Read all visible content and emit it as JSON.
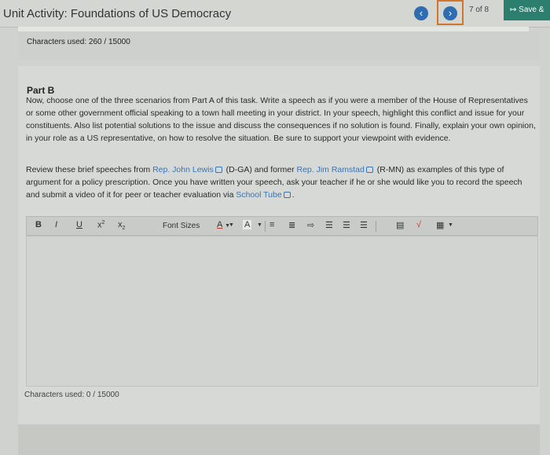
{
  "header": {
    "title": "Unit Activity: Foundations of US Democracy",
    "prev_icon": "chevron-left-icon",
    "next_icon": "chevron-right-icon",
    "page_count": "7 of 8",
    "save_label": "Save &",
    "colors": {
      "accent": "#2f6db0",
      "save": "#2c7f6e",
      "highlight": "#d2742c"
    }
  },
  "part_a": {
    "chars_used": "Characters used: 260 / 15000"
  },
  "part_b": {
    "heading": "Part B",
    "paragraph1": "Now, choose one of the three scenarios from Part A of this task. Write a speech as if you were a member of the House of Representatives or some other government official speaking to a town hall meeting in your district. In your speech, highlight this conflict and issue for your constituents. Also list potential solutions to the issue and discuss the consequences if no solution is found. Finally, explain your own opinion, in your role as a US representative, on how to resolve the situation. Be sure to support your viewpoint with evidence.",
    "p2_intro": "Review these brief speeches from ",
    "link1": "Rep. John Lewis",
    "p2_mid1": " (D-GA) and former ",
    "link2": "Rep. Jim Ramstad",
    "p2_mid2": " (R-MN) as examples of this type of argument for a policy prescription. Once you have written your speech, ask your teacher if he or she would like you to record the speech and submit a video of it for peer or teacher evaluation via ",
    "link3": "School Tube",
    "p2_end": "."
  },
  "toolbar": {
    "bold": "B",
    "italic": "I",
    "underline": "U",
    "superscript": "x",
    "subscript": "x",
    "font_sizes": "Font Sizes",
    "text_color": "A",
    "bg_color": "A"
  },
  "editor": {
    "value": "",
    "chars_used": "Characters used: 0 / 15000"
  }
}
